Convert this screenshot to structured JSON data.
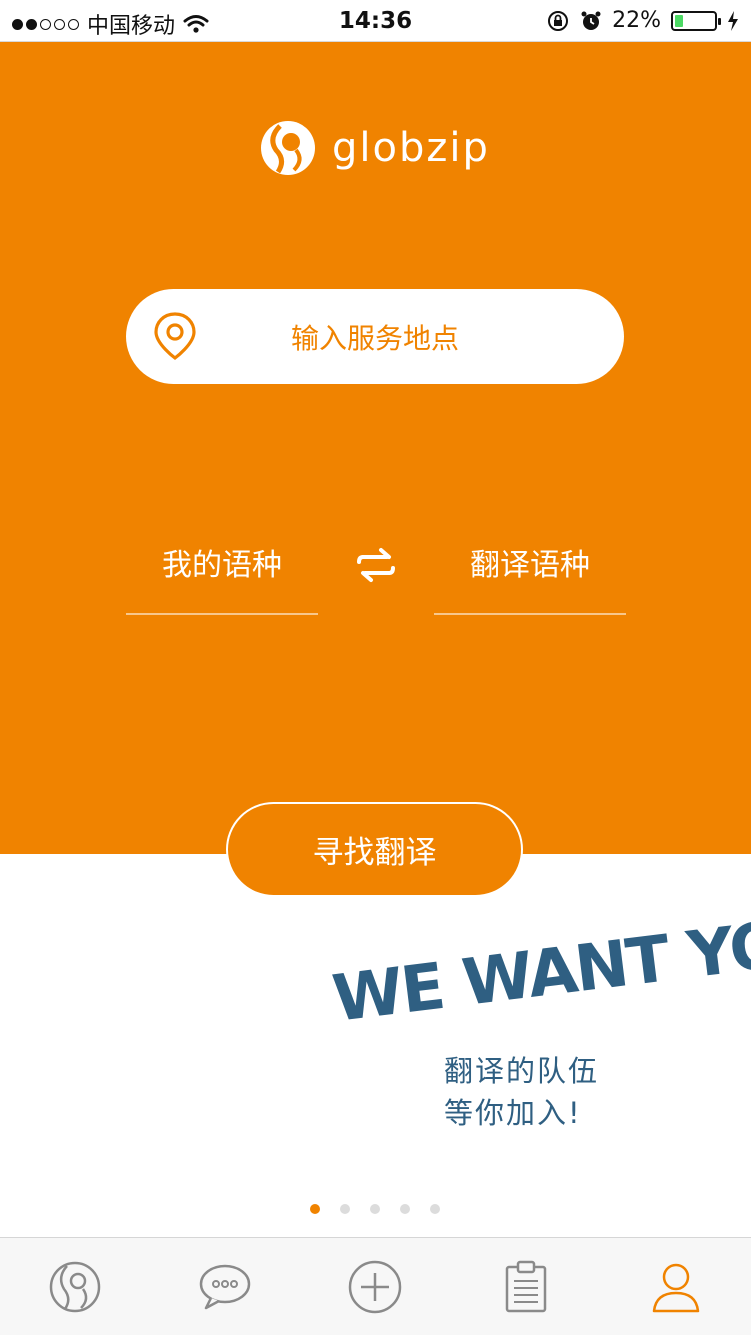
{
  "status_bar": {
    "carrier": "中国移动",
    "time": "14:36",
    "battery_percent": "22%",
    "battery_level": 0.22,
    "signal_bars_on": 2,
    "signal_bars_total": 5
  },
  "brand": {
    "name": "globzip"
  },
  "search": {
    "location_placeholder": "输入服务地点"
  },
  "languages": {
    "mine_label": "我的语种",
    "target_label": "翻译语种"
  },
  "actions": {
    "find_label": "寻找翻译"
  },
  "banner": {
    "slogan_line1": "翻译的队伍",
    "slogan_line2": "等你加入!",
    "artwork_text": "WE WANT YOU"
  },
  "pager": {
    "total": 5,
    "active_index": 0
  },
  "tabs": [
    {
      "icon": "globzip-logo-icon",
      "active": false
    },
    {
      "icon": "chat-bubble-icon",
      "active": false
    },
    {
      "icon": "plus-circle-icon",
      "active": false
    },
    {
      "icon": "clipboard-icon",
      "active": false
    },
    {
      "icon": "user-icon",
      "active": true
    }
  ],
  "colors": {
    "accent": "#f08300",
    "banner_text": "#2f5f82",
    "tab_inactive": "#8a8a8a"
  }
}
